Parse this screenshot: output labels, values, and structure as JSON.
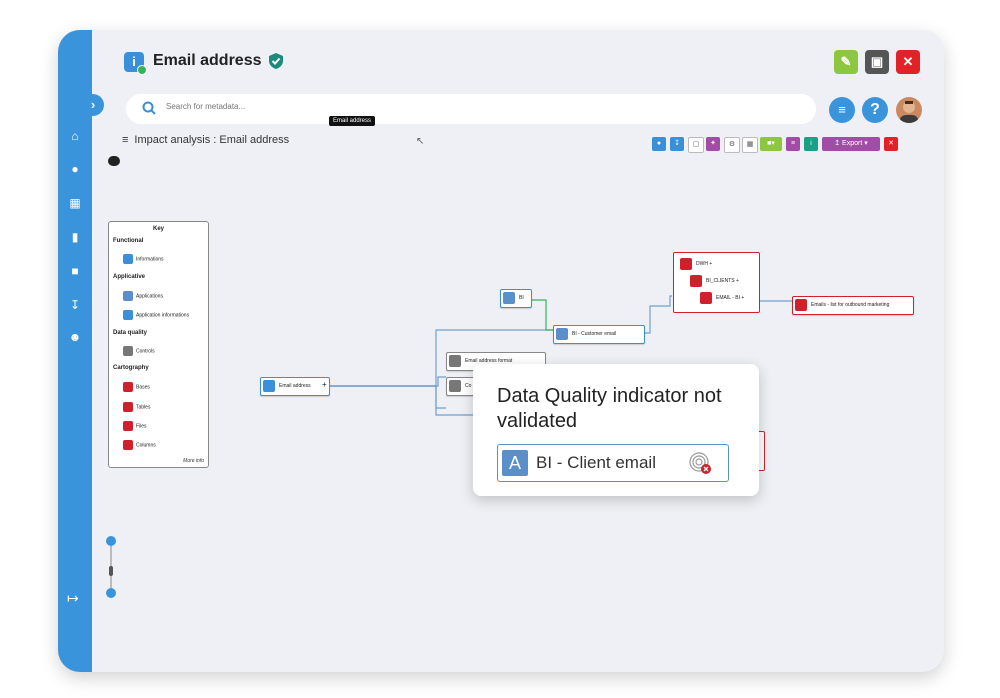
{
  "header": {
    "title": "Email address",
    "tooltip": "Email address",
    "search_placeholder": "Search for metadata..."
  },
  "breadcrumb": {
    "label": "Impact analysis : Email address"
  },
  "toolbar": {
    "export_label": "Export"
  },
  "key": {
    "title": "Key",
    "sections": {
      "functional": "Functional",
      "applicative": "Applicative",
      "data_quality": "Data quality",
      "cartography": "Cartography"
    },
    "items": {
      "informations": "Informations",
      "applications": "Applications",
      "application_informations": "Application informations",
      "controls": "Controls",
      "bases": "Bases",
      "tables": "Tables",
      "files": "Files",
      "columns": "Columns"
    },
    "more_info": "More info"
  },
  "graph": {
    "email_address_node": "Email address",
    "bi_node": "BI",
    "bi_customer_email": "BI - Customer email",
    "email_address_format": "Email address format",
    "co_node": "Co",
    "dwh": "DWH",
    "bi_clients": "BI_CLIENTS",
    "email_bi": "EMAIL - BI",
    "emails_list": "Emails - list for outbound marketing"
  },
  "popup": {
    "message": "Data Quality indicator not validated",
    "chip_letter": "A",
    "chip_label": "BI - Client email"
  },
  "colors": {
    "sidebar": "#3a94dc",
    "edit_button": "#8dc63f",
    "delete_button": "#555555",
    "close_button": "#e32227",
    "export_button": "#a24ca8"
  }
}
